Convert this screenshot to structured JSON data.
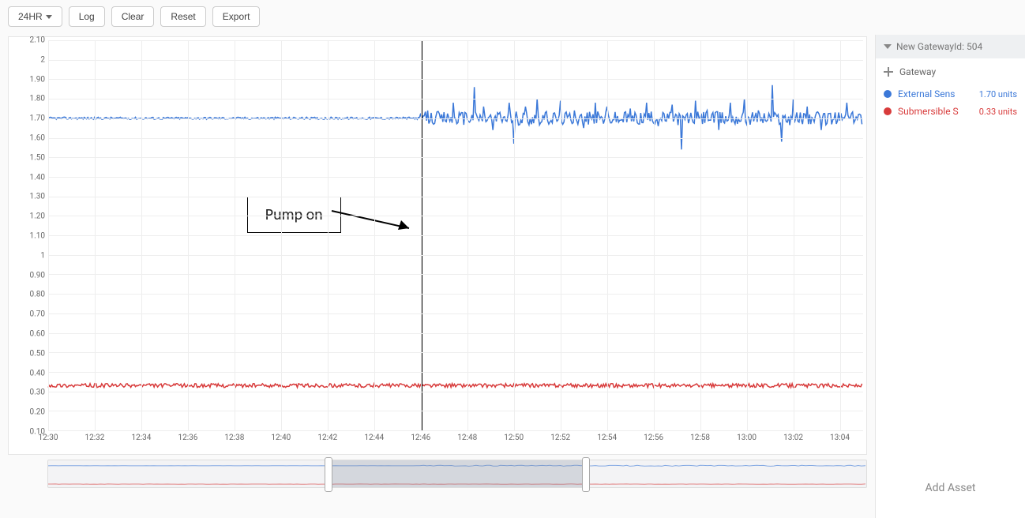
{
  "toolbar": {
    "range_label": "24HR",
    "log_label": "Log",
    "clear_label": "Clear",
    "reset_label": "Reset",
    "export_label": "Export"
  },
  "annotation": {
    "label": "Pump on"
  },
  "sidebar": {
    "gateway_header": "New GatewayId: 504",
    "gateway_add": "Gateway",
    "add_asset": "Add Asset"
  },
  "legend": [
    {
      "name": "External Sensor",
      "short": "External Sens",
      "color": "#3b78d8",
      "value": "1.70 units"
    },
    {
      "name": "Submersible Sensor",
      "short": "Submersible S",
      "color": "#d83b3b",
      "value": "0.33 units"
    }
  ],
  "chart_data": {
    "type": "line",
    "xlabel": "",
    "ylabel": "",
    "ylim": [
      0.1,
      2.1
    ],
    "y_ticks": [
      "0.10",
      "0.20",
      "0.30",
      "0.40",
      "0.50",
      "0.60",
      "0.70",
      "0.80",
      "0.90",
      "1",
      "1.10",
      "1.20",
      "1.30",
      "1.40",
      "1.50",
      "1.60",
      "1.70",
      "1.80",
      "1.90",
      "2",
      "2.10"
    ],
    "x_ticks": [
      "12:30",
      "12:32",
      "12:34",
      "12:36",
      "12:38",
      "12:40",
      "12:42",
      "12:44",
      "12:46",
      "12:48",
      "12:50",
      "12:52",
      "12:54",
      "12:56",
      "12:58",
      "13:00",
      "13:02",
      "13:04"
    ],
    "x_range_minutes": [
      0,
      35
    ],
    "cursor_at_minute": 16,
    "overview_selection_minutes": [
      12,
      23
    ],
    "series": [
      {
        "name": "External Sensor",
        "color": "#3b78d8",
        "baseline": 1.7,
        "noise_before_cursor": 0.006,
        "noise_after_cursor": 0.035,
        "spikes_after_cursor": [
          [
            16.3,
            1.74
          ],
          [
            16.9,
            1.72
          ],
          [
            17.4,
            1.78
          ],
          [
            17.9,
            1.73
          ],
          [
            18.3,
            1.86
          ],
          [
            18.7,
            1.76
          ],
          [
            19.1,
            1.64
          ],
          [
            19.4,
            1.73
          ],
          [
            19.8,
            1.78
          ],
          [
            20.0,
            1.57
          ],
          [
            20.5,
            1.76
          ],
          [
            21.0,
            1.8
          ],
          [
            21.5,
            1.67
          ],
          [
            22.0,
            1.79
          ],
          [
            22.6,
            1.74
          ],
          [
            23.0,
            1.65
          ],
          [
            23.5,
            1.78
          ],
          [
            24.0,
            1.76
          ],
          [
            24.5,
            1.68
          ],
          [
            25.0,
            1.75
          ],
          [
            25.7,
            1.78
          ],
          [
            26.2,
            1.66
          ],
          [
            26.8,
            1.77
          ],
          [
            27.2,
            1.54
          ],
          [
            27.8,
            1.79
          ],
          [
            28.3,
            1.74
          ],
          [
            28.8,
            1.64
          ],
          [
            29.3,
            1.78
          ],
          [
            29.9,
            1.8
          ],
          [
            30.5,
            1.74
          ],
          [
            31.1,
            1.87
          ],
          [
            31.5,
            1.58
          ],
          [
            32.0,
            1.8
          ],
          [
            32.6,
            1.76
          ],
          [
            33.2,
            1.64
          ],
          [
            33.8,
            1.73
          ],
          [
            34.3,
            1.78
          ],
          [
            34.8,
            1.72
          ]
        ]
      },
      {
        "name": "Submersible Sensor",
        "color": "#d83b3b",
        "baseline": 0.33,
        "noise_before_cursor": 0.01,
        "noise_after_cursor": 0.01,
        "spikes_after_cursor": []
      }
    ]
  }
}
